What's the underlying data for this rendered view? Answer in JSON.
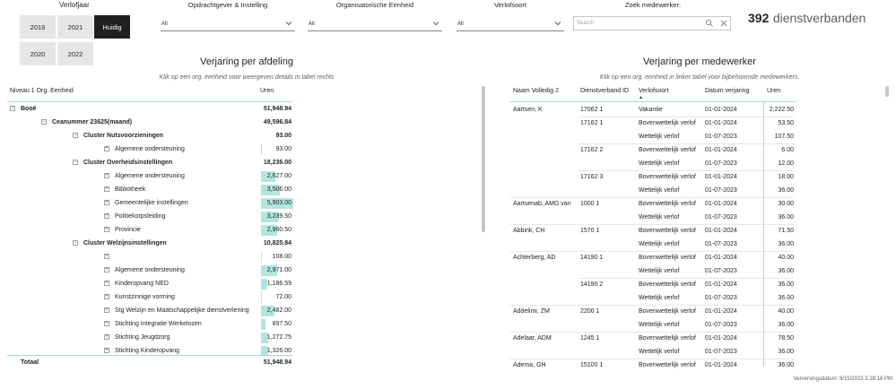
{
  "year_slicer": {
    "title": "Verlofjaar",
    "options": [
      {
        "label": "2019",
        "active": false
      },
      {
        "label": "2021",
        "active": false
      },
      {
        "label": "Huidig",
        "active": true
      },
      {
        "label": "2020",
        "active": false
      },
      {
        "label": "2022",
        "active": false
      }
    ]
  },
  "filters": [
    {
      "label": "Opdrachtgever & Instelling",
      "value": "All"
    },
    {
      "label": "Organisatorische Eenheid",
      "value": "All"
    },
    {
      "label": "Verlofsoort",
      "value": "All"
    }
  ],
  "search": {
    "label": "Zoek medewerker:",
    "placeholder": "Search"
  },
  "kpi": {
    "value": "392",
    "label": "dienstverbanden"
  },
  "left_table": {
    "title": "Verjaring per afdeling",
    "subtitle": "Klik op een org.  eenheid voor weergeven details in tabel rechts",
    "headers": [
      "Niveau 1 Org. Eenheid",
      "Uren"
    ],
    "rows": [
      {
        "label": "Booé",
        "value": "51,948.94",
        "bold": true,
        "level": 0,
        "expander": "−",
        "bar": 0
      },
      {
        "label": "Ceanummer 23625(maand)",
        "value": "49,596.84",
        "bold": true,
        "level": 1,
        "expander": "−",
        "bar": 0
      },
      {
        "label": "Cluster Nutsvoorzieningen",
        "value": "93.00",
        "bold": true,
        "level": 2,
        "expander": "−",
        "bar": 0
      },
      {
        "label": "Algemene ondersteuning",
        "value": "93.00",
        "bold": false,
        "level": 3,
        "expander": "+",
        "bar": 0.016
      },
      {
        "label": "Cluster Overheidsinstellingen",
        "value": "18,236.00",
        "bold": true,
        "level": 2,
        "expander": "−",
        "bar": 0
      },
      {
        "label": "Algemene ondersteuning",
        "value": "2,627.00",
        "bold": false,
        "level": 3,
        "expander": "+",
        "bar": 0.445
      },
      {
        "label": "Bibliotheek",
        "value": "3,506.00",
        "bold": false,
        "level": 3,
        "expander": "+",
        "bar": 0.594
      },
      {
        "label": "Gemeentelijke instellingen",
        "value": "5,903.00",
        "bold": false,
        "level": 3,
        "expander": "+",
        "bar": 1.0
      },
      {
        "label": "Politiekorpsleiding",
        "value": "3,239.50",
        "bold": false,
        "level": 3,
        "expander": "+",
        "bar": 0.549
      },
      {
        "label": "Provincie",
        "value": "2,960.50",
        "bold": false,
        "level": 3,
        "expander": "+",
        "bar": 0.502
      },
      {
        "label": "Cluster Welzijnsinstellingen",
        "value": "10,825.84",
        "bold": true,
        "level": 2,
        "expander": "−",
        "bar": 0
      },
      {
        "label": "",
        "value": "108.00",
        "bold": false,
        "level": 3,
        "expander": "+",
        "bar": 0.018
      },
      {
        "label": "Algemene ondersteuning",
        "value": "2,971.00",
        "bold": false,
        "level": 3,
        "expander": "+",
        "bar": 0.503
      },
      {
        "label": "Kinderopvang NED",
        "value": "1,186.59",
        "bold": false,
        "level": 3,
        "expander": "+",
        "bar": 0.201
      },
      {
        "label": "Kunstzinnige vorming",
        "value": "72.00",
        "bold": false,
        "level": 3,
        "expander": "+",
        "bar": 0.012
      },
      {
        "label": "Stg Welzijn en Maatschappelijke dienstverlening",
        "value": "2,482.00",
        "bold": false,
        "level": 3,
        "expander": "+",
        "bar": 0.42
      },
      {
        "label": "Stichting Integratie Werkelozen",
        "value": "897.50",
        "bold": false,
        "level": 3,
        "expander": "+",
        "bar": 0.152
      },
      {
        "label": "Stichting Jeugdzorg",
        "value": "1,272.75",
        "bold": false,
        "level": 3,
        "expander": "+",
        "bar": 0.216
      },
      {
        "label": "Stichting Kinderopvang",
        "value": "1,326.00",
        "bold": false,
        "level": 3,
        "expander": "+",
        "bar": 0.225
      }
    ],
    "total_label": "Totaal",
    "total_value": "51,948.94"
  },
  "right_table": {
    "title": "Verjaring per medewerker",
    "subtitle": "Klik op een org.  eenheid in linker tabel voor bijbehorende medewerkers.",
    "headers": [
      "Naam Volledig 2",
      "Dienstverband ID",
      "Verlofsoort",
      "Datum verjaring",
      "Uren"
    ],
    "sort_indicator": "▲",
    "rows": [
      {
        "naam": "Aartsen, K",
        "id": "17062 1",
        "soort": "Vakantie",
        "datum": "01-01-2024",
        "uren": "2,222.50",
        "sep": false
      },
      {
        "naam": "",
        "id": "17162 1",
        "soort": "Bovenwettelijk verlof",
        "datum": "01-01-2024",
        "uren": "53.50",
        "sep": true
      },
      {
        "naam": "",
        "id": "",
        "soort": "Wettelijk verlof",
        "datum": "01-07-2023",
        "uren": "107.50",
        "sep": false
      },
      {
        "naam": "",
        "id": "17162 2",
        "soort": "Bovenwettelijk verlof",
        "datum": "01-01-2024",
        "uren": "6.00",
        "sep": true
      },
      {
        "naam": "",
        "id": "",
        "soort": "Wettelijk verlof",
        "datum": "01-07-2023",
        "uren": "12.00",
        "sep": false
      },
      {
        "naam": "",
        "id": "17162 3",
        "soort": "Bovenwettelijk verlof",
        "datum": "01-01-2024",
        "uren": "18.00",
        "sep": true
      },
      {
        "naam": "",
        "id": "",
        "soort": "Wettelijk verlof",
        "datum": "01-07-2023",
        "uren": "36.00",
        "sep": false
      },
      {
        "naam": "Aartsenab, AMG van",
        "id": "1000 1",
        "soort": "Bovenwettelijk verlof",
        "datum": "01-01-2024",
        "uren": "30.00",
        "sep": true
      },
      {
        "naam": "",
        "id": "",
        "soort": "Wettelijk verlof",
        "datum": "01-07-2023",
        "uren": "36.00",
        "sep": false
      },
      {
        "naam": "Abbink, CH",
        "id": "1570 1",
        "soort": "Bovenwettelijk verlof",
        "datum": "01-01-2024",
        "uren": "71.50",
        "sep": true
      },
      {
        "naam": "",
        "id": "",
        "soort": "Wettelijk verlof",
        "datum": "01-07-2023",
        "uren": "36.00",
        "sep": false
      },
      {
        "naam": "Achterberg, AD",
        "id": "14190 1",
        "soort": "Bovenwettelijk verlof",
        "datum": "01-01-2024",
        "uren": "40.00",
        "sep": true
      },
      {
        "naam": "",
        "id": "",
        "soort": "Wettelijk verlof",
        "datum": "01-07-2023",
        "uren": "36.00",
        "sep": false
      },
      {
        "naam": "",
        "id": "14190 2",
        "soort": "Bovenwettelijk verlof",
        "datum": "01-01-2024",
        "uren": "36.00",
        "sep": true
      },
      {
        "naam": "",
        "id": "",
        "soort": "Wettelijk verlof",
        "datum": "01-07-2023",
        "uren": "36.00",
        "sep": false
      },
      {
        "naam": "Addelimi, ZM",
        "id": "2200 1",
        "soort": "Bovenwettelijk verlof",
        "datum": "01-01-2024",
        "uren": "40.00",
        "sep": true
      },
      {
        "naam": "",
        "id": "",
        "soort": "Wettelijk verlof",
        "datum": "01-07-2023",
        "uren": "36.00",
        "sep": false
      },
      {
        "naam": "Adelaar, ADM",
        "id": "1245 1",
        "soort": "Bovenwettelijk verlof",
        "datum": "01-01-2024",
        "uren": "78.50",
        "sep": true
      },
      {
        "naam": "",
        "id": "",
        "soort": "Wettelijk verlof",
        "datum": "01-07-2023",
        "uren": "36.00",
        "sep": false
      },
      {
        "naam": "Adema, GH",
        "id": "15100 1",
        "soort": "Bovenwettelijk verlof",
        "datum": "01-01-2024",
        "uren": "36.00",
        "sep": true
      }
    ]
  },
  "footer": "Verversingsdatum: 8/15/2023 3:28:18 PM",
  "colors": {
    "databar": "#b3e5e0",
    "accent_line": "#9ee0d8",
    "active_button": "#1f1f1f"
  }
}
